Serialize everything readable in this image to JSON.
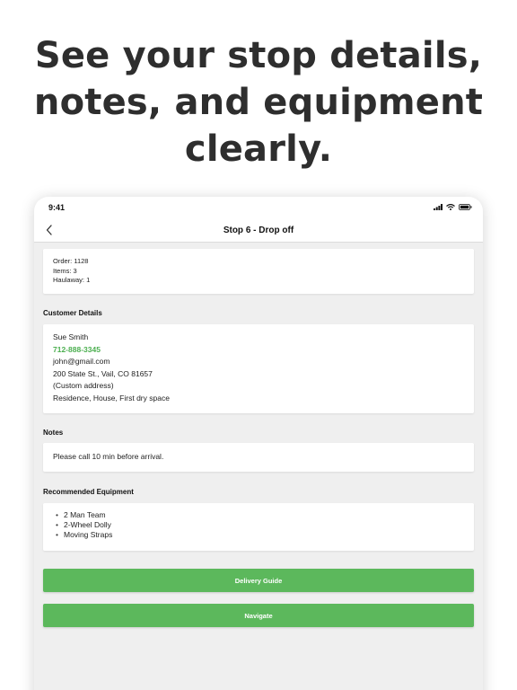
{
  "headline": [
    "See your stop details,",
    "notes, and equipment",
    "clearly."
  ],
  "status_bar": {
    "time": "9:41",
    "icons": [
      "signal-icon",
      "wifi-icon",
      "battery-icon"
    ]
  },
  "nav": {
    "back_icon": "chevron-left-icon",
    "title": "Stop 6 - Drop off"
  },
  "order": {
    "order_line": "Order: 1128",
    "items_line": "Items: 3",
    "haulaway_line": "Haulaway: 1"
  },
  "customer": {
    "section_title": "Customer Details",
    "name": "Sue Smith",
    "phone": "712-888-3345",
    "email": "john@gmail.com",
    "address": "200 State St., Vail, CO 81657",
    "address_note": "(Custom address)",
    "location_type": "Residence, House, First dry space"
  },
  "notes": {
    "section_title": "Notes",
    "text": "Please call 10 min before arrival."
  },
  "equipment": {
    "section_title": "Recommended Equipment",
    "items": [
      "2 Man Team",
      "2-Wheel Dolly",
      "Moving Straps"
    ]
  },
  "buttons": {
    "delivery_guide": "Delivery Guide",
    "navigate": "Navigate"
  },
  "colors": {
    "accent_green": "#5cb85c",
    "phone_green": "#4caf50",
    "headline_text": "#2e2e2e"
  }
}
